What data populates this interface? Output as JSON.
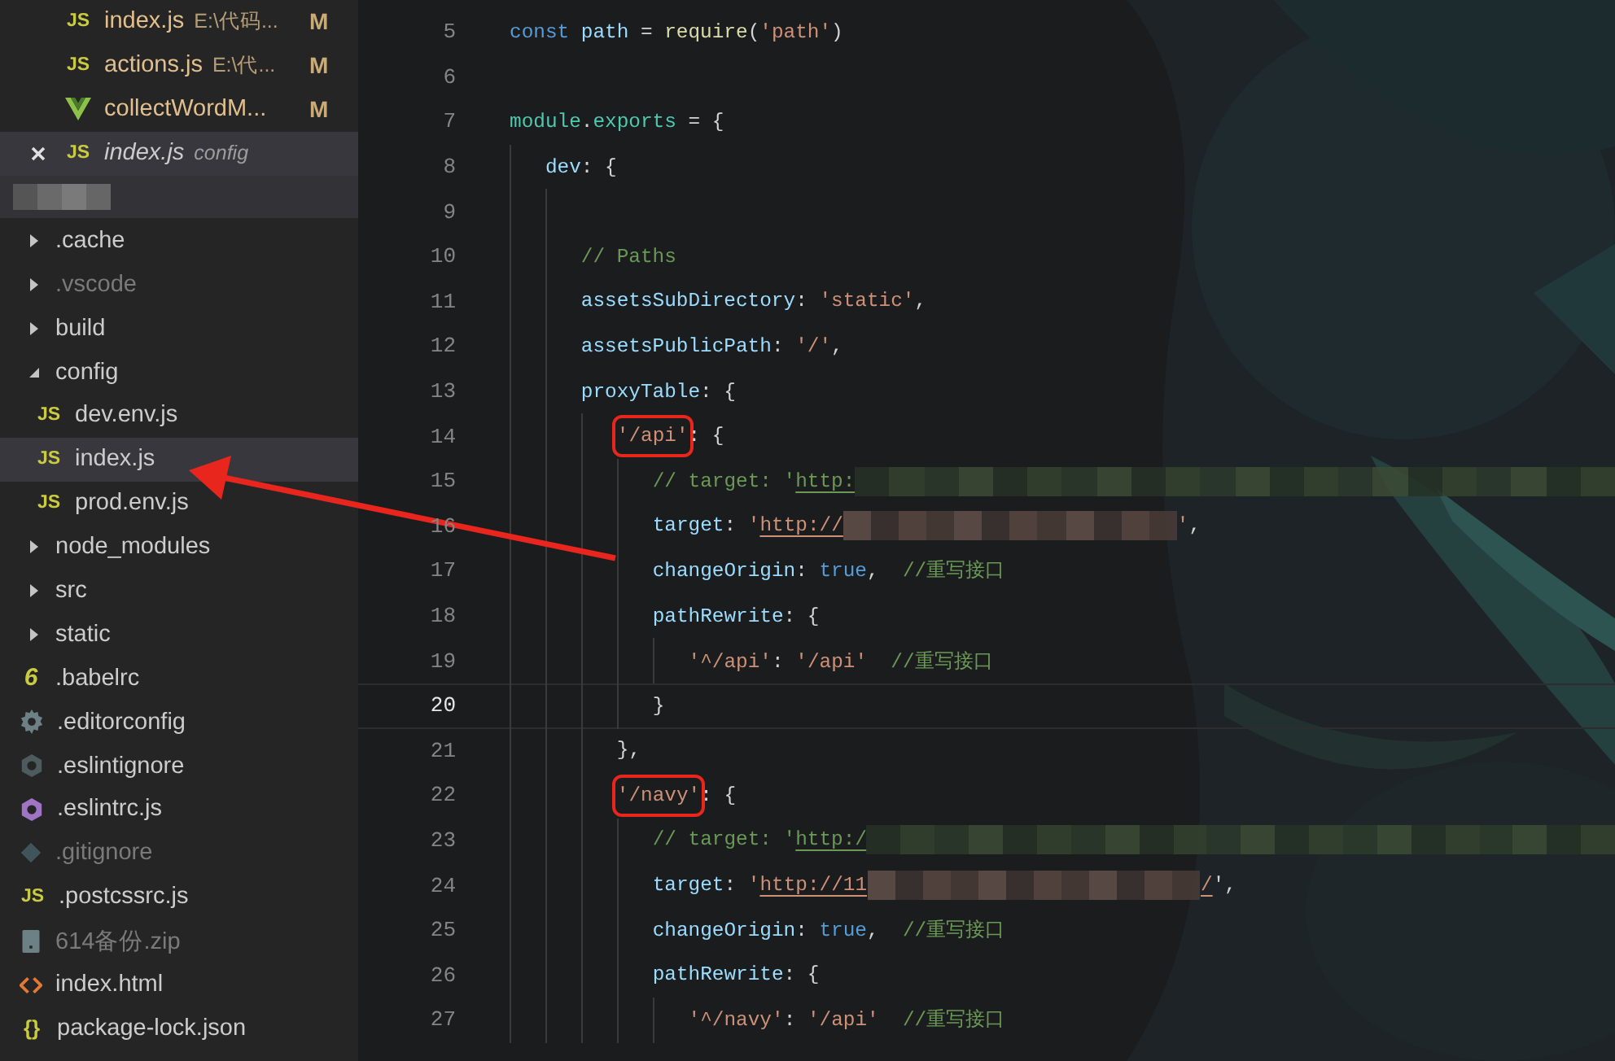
{
  "open_editors": [
    {
      "kind": "js-file",
      "icon_text": "JS",
      "name": "index.js",
      "path": "E:\\代码...",
      "badge": "M",
      "modified": true,
      "preview": false,
      "closable": false,
      "selected": false
    },
    {
      "kind": "js-file",
      "icon_text": "JS",
      "name": "actions.js",
      "path": "E:\\代...",
      "badge": "M",
      "modified": true,
      "preview": false,
      "closable": false,
      "selected": false
    },
    {
      "kind": "vue-file",
      "name": "collectWordM...",
      "badge": "M",
      "modified": true,
      "preview": false,
      "closable": false,
      "selected": false
    },
    {
      "kind": "js-file",
      "icon_text": "JS",
      "name": "index.js",
      "path": "config",
      "modified": false,
      "preview": true,
      "closable": true,
      "selected": true
    }
  ],
  "project_header": {
    "obscured": true
  },
  "tree": [
    {
      "kind": "folder",
      "name": ".cache",
      "expanded": false,
      "dimmed": false,
      "selected": false
    },
    {
      "kind": "folder",
      "name": ".vscode",
      "expanded": false,
      "dimmed": true,
      "selected": false
    },
    {
      "kind": "folder",
      "name": "build",
      "expanded": false,
      "dimmed": false,
      "selected": false
    },
    {
      "kind": "folder",
      "name": "config",
      "expanded": true,
      "dimmed": false,
      "selected": false,
      "children": [
        {
          "kind": "js-file",
          "icon_text": "JS",
          "name": "dev.env.js",
          "dimmed": false,
          "selected": false
        },
        {
          "kind": "js-file",
          "icon_text": "JS",
          "name": "index.js",
          "dimmed": false,
          "selected": true
        },
        {
          "kind": "js-file",
          "icon_text": "JS",
          "name": "prod.env.js",
          "dimmed": false,
          "selected": false
        }
      ]
    },
    {
      "kind": "folder",
      "name": "node_modules",
      "expanded": false,
      "dimmed": false,
      "selected": false
    },
    {
      "kind": "folder",
      "name": "src",
      "expanded": false,
      "dimmed": false,
      "selected": false
    },
    {
      "kind": "folder",
      "name": "static",
      "expanded": false,
      "dimmed": false,
      "selected": false
    },
    {
      "kind": "babel-file",
      "icon_text": "6",
      "name": ".babelrc",
      "dimmed": false,
      "selected": false
    },
    {
      "kind": "settings-file",
      "name": ".editorconfig",
      "dimmed": false,
      "selected": false
    },
    {
      "kind": "ignore-file",
      "name": ".eslintignore",
      "dimmed": false,
      "selected": false
    },
    {
      "kind": "lint-file",
      "name": ".eslintrc.js",
      "dimmed": false,
      "selected": false
    },
    {
      "kind": "git-file",
      "name": ".gitignore",
      "dimmed": true,
      "selected": false
    },
    {
      "kind": "js-file",
      "icon_text": "JS",
      "name": ".postcssrc.js",
      "dimmed": false,
      "selected": false
    },
    {
      "kind": "archive-file",
      "name": "614备份.zip",
      "dimmed": true,
      "selected": false
    },
    {
      "kind": "html-file",
      "name": "index.html",
      "dimmed": false,
      "selected": false
    },
    {
      "kind": "json-file",
      "icon_text": "{}",
      "name": "package-lock.json",
      "dimmed": false,
      "selected": false
    }
  ],
  "code_lines": [
    {
      "number": "5",
      "current": false,
      "tokens": [
        {
          "kind": "keyword",
          "text": "const "
        },
        {
          "kind": "variable",
          "text": "path"
        },
        {
          "kind": "plain",
          "text": " = "
        },
        {
          "kind": "function",
          "text": "require"
        },
        {
          "kind": "plain",
          "text": "("
        },
        {
          "kind": "string",
          "text": "'path'"
        },
        {
          "kind": "plain",
          "text": ")"
        }
      ]
    },
    {
      "number": "6",
      "current": false
    },
    {
      "number": "7",
      "current": false,
      "tokens": [
        {
          "kind": "type",
          "text": "module"
        },
        {
          "kind": "plain",
          "text": "."
        },
        {
          "kind": "type",
          "text": "exports"
        },
        {
          "kind": "plain",
          "text": " = {"
        }
      ]
    },
    {
      "number": "8",
      "current": false,
      "tokens": [
        {
          "kind": "property",
          "text": "   dev"
        },
        {
          "kind": "plain",
          "text": ": {"
        }
      ]
    },
    {
      "number": "9",
      "current": false
    },
    {
      "number": "10",
      "current": false,
      "tokens": [
        {
          "kind": "comment",
          "text": "      // Paths"
        }
      ]
    },
    {
      "number": "11",
      "current": false,
      "tokens": [
        {
          "kind": "property",
          "text": "      assetsSubDirectory"
        },
        {
          "kind": "plain",
          "text": ": "
        },
        {
          "kind": "string",
          "text": "'static'"
        },
        {
          "kind": "plain",
          "text": ","
        }
      ]
    },
    {
      "number": "12",
      "current": false,
      "tokens": [
        {
          "kind": "property",
          "text": "      assetsPublicPath"
        },
        {
          "kind": "plain",
          "text": ": "
        },
        {
          "kind": "string",
          "text": "'/'"
        },
        {
          "kind": "plain",
          "text": ","
        }
      ]
    },
    {
      "number": "13",
      "current": false,
      "tokens": [
        {
          "kind": "property",
          "text": "      proxyTable"
        },
        {
          "kind": "plain",
          "text": ": {"
        }
      ]
    },
    {
      "number": "14",
      "current": false,
      "tokens": [
        {
          "kind": "string",
          "text": "         '/api'",
          "boxed": true
        },
        {
          "kind": "plain",
          "text": ": {"
        }
      ]
    },
    {
      "number": "15",
      "current": false,
      "tokens": [
        {
          "kind": "comment",
          "text": "            // target: '"
        },
        {
          "kind": "comment",
          "text": "http:",
          "link": true
        },
        {
          "kind": "blur-long"
        }
      ]
    },
    {
      "number": "16",
      "current": false,
      "tokens": [
        {
          "kind": "property",
          "text": "            target"
        },
        {
          "kind": "plain",
          "text": ": "
        },
        {
          "kind": "string",
          "text": "'"
        },
        {
          "kind": "string",
          "text": "http://",
          "link": true
        },
        {
          "kind": "blur-medium"
        },
        {
          "kind": "string",
          "text": "'"
        },
        {
          "kind": "plain",
          "text": ","
        }
      ]
    },
    {
      "number": "17",
      "current": false,
      "tokens": [
        {
          "kind": "property",
          "text": "            changeOrigin"
        },
        {
          "kind": "plain",
          "text": ": "
        },
        {
          "kind": "keyword",
          "text": "true"
        },
        {
          "kind": "plain",
          "text": ",  "
        },
        {
          "kind": "comment",
          "text": "//重写接口"
        }
      ]
    },
    {
      "number": "18",
      "current": false,
      "tokens": [
        {
          "kind": "property",
          "text": "            pathRewrite"
        },
        {
          "kind": "plain",
          "text": ": {"
        }
      ]
    },
    {
      "number": "19",
      "current": false,
      "tokens": [
        {
          "kind": "string",
          "text": "               '^/api'"
        },
        {
          "kind": "plain",
          "text": ": "
        },
        {
          "kind": "string",
          "text": "'/api'"
        },
        {
          "kind": "comment",
          "text": "  //重写接口"
        }
      ]
    },
    {
      "number": "20",
      "current": true,
      "tokens": [
        {
          "kind": "plain",
          "text": "            }"
        }
      ]
    },
    {
      "number": "21",
      "current": false,
      "tokens": [
        {
          "kind": "plain",
          "text": "         },"
        }
      ]
    },
    {
      "number": "22",
      "current": false,
      "tokens": [
        {
          "kind": "string",
          "text": "         '/navy'",
          "boxed": true
        },
        {
          "kind": "plain",
          "text": ": {"
        }
      ]
    },
    {
      "number": "23",
      "current": false,
      "tokens": [
        {
          "kind": "comment",
          "text": "            // target: '"
        },
        {
          "kind": "comment",
          "text": "http:/",
          "link": true
        },
        {
          "kind": "blur-long"
        }
      ]
    },
    {
      "number": "24",
      "current": false,
      "tokens": [
        {
          "kind": "property",
          "text": "            target"
        },
        {
          "kind": "plain",
          "text": ": "
        },
        {
          "kind": "string",
          "text": "'"
        },
        {
          "kind": "string",
          "text": "http://11",
          "link": true
        },
        {
          "kind": "blur-medium"
        },
        {
          "kind": "string",
          "text": "/",
          "link": true
        },
        {
          "kind": "plain",
          "text": "',"
        }
      ]
    },
    {
      "number": "25",
      "current": false,
      "tokens": [
        {
          "kind": "property",
          "text": "            changeOrigin"
        },
        {
          "kind": "plain",
          "text": ": "
        },
        {
          "kind": "keyword",
          "text": "true"
        },
        {
          "kind": "plain",
          "text": ",  "
        },
        {
          "kind": "comment",
          "text": "//重写接口"
        }
      ]
    },
    {
      "number": "26",
      "current": false,
      "tokens": [
        {
          "kind": "property",
          "text": "            pathRewrite"
        },
        {
          "kind": "plain",
          "text": ": {"
        }
      ]
    },
    {
      "number": "27",
      "current": false,
      "tokens": [
        {
          "kind": "string",
          "text": "               '^/navy'"
        },
        {
          "kind": "plain",
          "text": ": "
        },
        {
          "kind": "string",
          "text": "'/api'"
        },
        {
          "kind": "comment",
          "text": "  //重写接口"
        }
      ]
    }
  ]
}
